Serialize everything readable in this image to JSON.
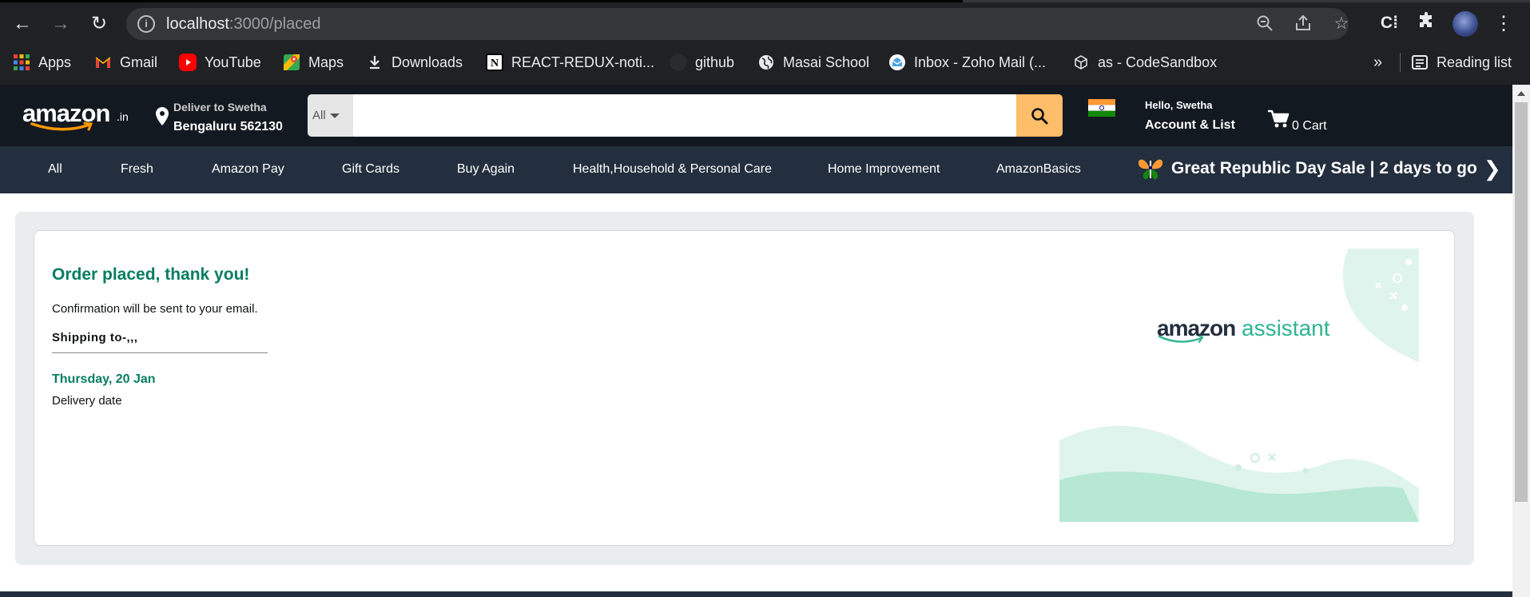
{
  "browser": {
    "url_host": "localhost",
    "url_path": ":3000/placed",
    "icons": [
      "back-icon",
      "forward-icon",
      "reload-icon",
      "site-info-icon",
      "zoom-out-icon",
      "share-icon",
      "star-icon",
      "extension-c-icon",
      "puzzle-icon",
      "profile-avatar",
      "more-menu-icon"
    ],
    "bookmarks": [
      {
        "label": "Apps",
        "icon": "apps-grid-icon"
      },
      {
        "label": "Gmail",
        "icon": "gmail-icon"
      },
      {
        "label": "YouTube",
        "icon": "youtube-icon"
      },
      {
        "label": "Maps",
        "icon": "maps-icon"
      },
      {
        "label": "Downloads",
        "icon": "download-icon"
      },
      {
        "label": "REACT-REDUX-noti...",
        "icon": "notion-icon"
      },
      {
        "label": "github",
        "icon": "github-icon"
      },
      {
        "label": "Masai School",
        "icon": "globe-icon"
      },
      {
        "label": "Inbox - Zoho Mail (...",
        "icon": "zoho-mail-icon"
      },
      {
        "label": "as - CodeSandbox",
        "icon": "codesandbox-icon"
      }
    ],
    "overflow_label": "»",
    "reading_list_label": "Reading list"
  },
  "header": {
    "logo_text": "amazon",
    "logo_suffix": ".in",
    "deliver_line1": "Deliver to Swetha",
    "deliver_line2": "Bengaluru 562130",
    "search_category": "All",
    "search_value": "",
    "hello": "Hello, Swetha",
    "account": "Account & List",
    "cart_label": "0 Cart",
    "colors": {
      "header_bg": "#131921",
      "subnav_bg": "#232f3e",
      "search_button": "#febd69"
    }
  },
  "subnav": {
    "items": [
      "All",
      "Fresh",
      "Amazon Pay",
      "Gift Cards",
      "Buy Again",
      "Health,Household & Personal Care",
      "Home Improvement",
      "AmazonBasics"
    ],
    "promo": "Great Republic Day Sale | 2 days to go",
    "promo_arrow": "❯"
  },
  "order": {
    "title": "Order placed, thank you!",
    "confirmation": "Confirmation will be sent to your email.",
    "shipping": "Shipping to-,,,",
    "delivery_day": "Thursday, 20 Jan",
    "delivery_label": "Delivery date",
    "accent_color": "#067d62"
  },
  "assistant_banner": {
    "brand": "amazon",
    "product": "assistant"
  }
}
